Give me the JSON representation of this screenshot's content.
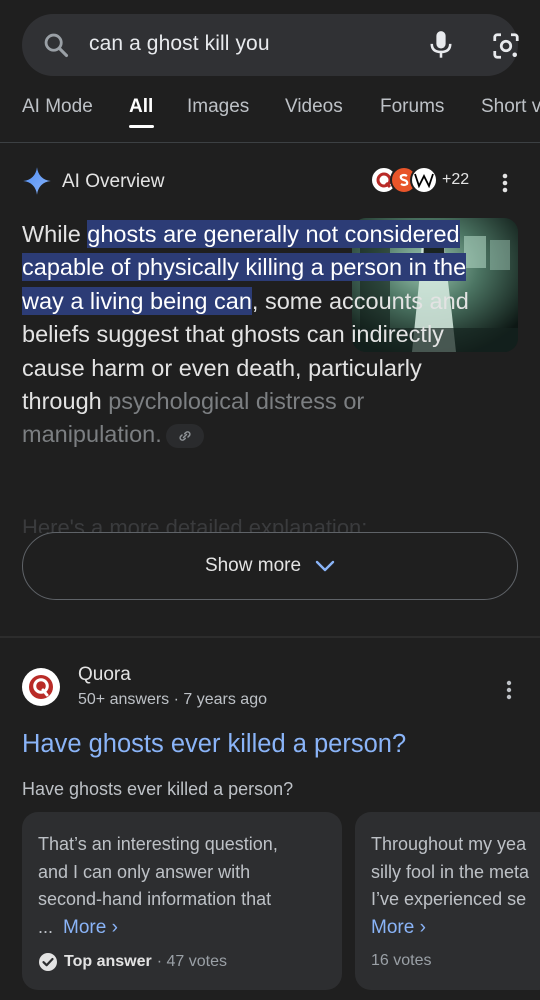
{
  "search": {
    "query": "can a ghost kill you"
  },
  "tabs": [
    "AI Mode",
    "All",
    "Images",
    "Videos",
    "Forums",
    "Short v"
  ],
  "ai_overview": {
    "title": "AI Overview",
    "source_count": "+22",
    "text_before": "While ",
    "text_highlight": "ghosts are generally not considered capable of physically killing a person in the way a living being can",
    "text_after": ", some accounts and beliefs suggest that ghosts can indirectly cause harm or even death, particularly through ",
    "text_faded": "psychological distress or manipulation.",
    "faded_next": "Here's a more detailed explanation:",
    "show_more": "Show more"
  },
  "result": {
    "site": "Quora",
    "meta": "50+ answers · 7 years ago",
    "title": "Have ghosts ever killed a person?",
    "snippet": "Have ghosts ever killed a person?",
    "answers": [
      {
        "lines": [
          "That’s an interesting question,",
          "and I can only answer with",
          "second-hand information that"
        ],
        "ellipsis": "...",
        "more": "More ›",
        "badge": "Top answer",
        "votes": "· 47 votes"
      },
      {
        "lines": [
          "Throughout my yea",
          "silly fool in the meta",
          "I’ve experienced se"
        ],
        "more": "More ›",
        "votes": "16 votes"
      }
    ]
  },
  "colors": {
    "background": "#1f1f1f",
    "highlight": "#2c3c76",
    "link": "#8ab4f8"
  },
  "icons": [
    "search-icon",
    "mic-icon",
    "lens-icon",
    "ai-sparkle-icon",
    "quora-icon",
    "w-icon",
    "link-icon",
    "chevron-down-icon",
    "kebab-icon",
    "check-circle-icon"
  ]
}
